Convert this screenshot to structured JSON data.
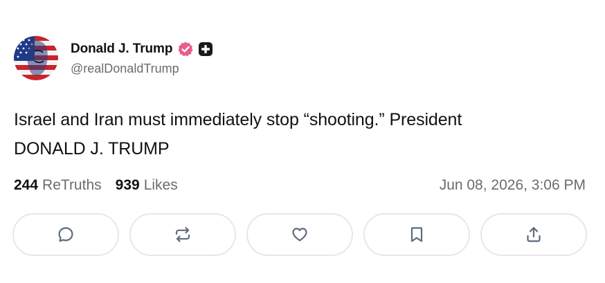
{
  "author": {
    "display_name": "Donald J. Trump",
    "handle": "@realDonaldTrump",
    "verified_color": "#e85d8a",
    "badge_icon": "plus-badge-icon"
  },
  "post": {
    "text_line_1": "Israel and Iran must immediately stop “shooting.” President",
    "text_line_2": "DONALD J. TRUMP"
  },
  "stats": {
    "retruths_count": "244",
    "retruths_label": "ReTruths",
    "likes_count": "939",
    "likes_label": "Likes",
    "timestamp": "Jun 08, 2026, 3:06 PM"
  },
  "actions": [
    {
      "name": "reply",
      "icon": "comment-icon"
    },
    {
      "name": "retruth",
      "icon": "repost-icon"
    },
    {
      "name": "like",
      "icon": "heart-icon"
    },
    {
      "name": "bookmark",
      "icon": "bookmark-icon"
    },
    {
      "name": "share",
      "icon": "share-icon"
    }
  ],
  "colors": {
    "text_primary": "#111111",
    "text_secondary": "#6b6b70",
    "button_border": "#e7e7ea",
    "icon_color": "#5c6b7f"
  }
}
